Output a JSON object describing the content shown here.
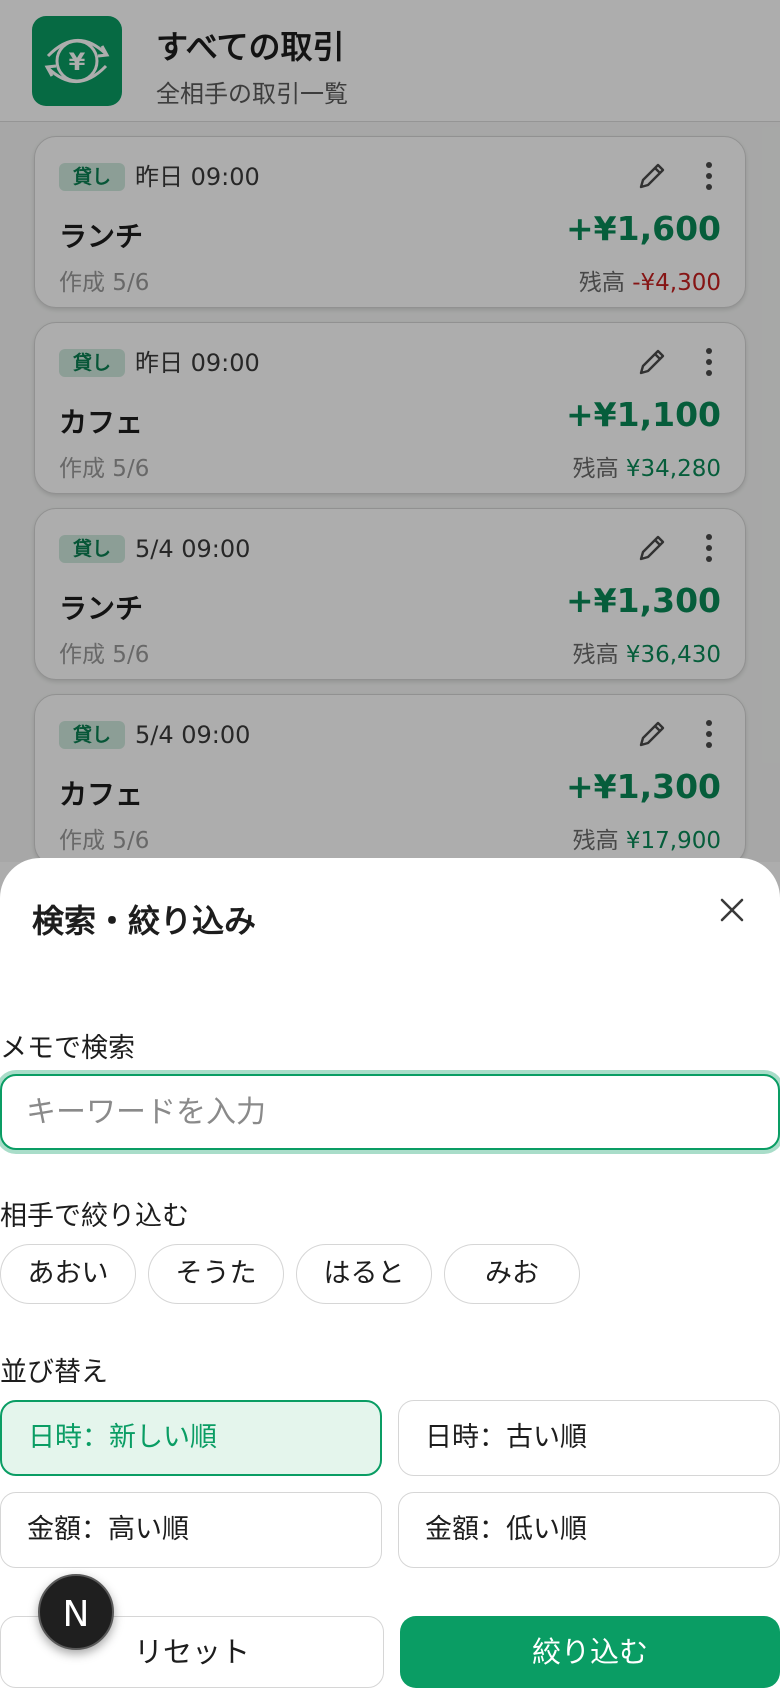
{
  "header": {
    "title": "すべての取引",
    "subtitle": "全相手の取引一覧",
    "icon": "yen-exchange-icon",
    "icon_glyph": "¥"
  },
  "transactions": [
    {
      "badge": "貸し",
      "date": "昨日 09:00",
      "title": "ランチ",
      "created": "作成 5/6",
      "amount": "+¥1,600",
      "balance_label": "残高",
      "balance": "-¥4,300"
    },
    {
      "badge": "貸し",
      "date": "昨日 09:00",
      "title": "カフェ",
      "created": "作成 5/6",
      "amount": "+¥1,100",
      "balance_label": "残高",
      "balance": "¥34,280"
    },
    {
      "badge": "貸し",
      "date": "5/4 09:00",
      "title": "ランチ",
      "created": "作成 5/6",
      "amount": "+¥1,300",
      "balance_label": "残高",
      "balance": "¥36,430"
    },
    {
      "badge": "貸し",
      "date": "5/4 09:00",
      "title": "カフェ",
      "created": "作成 5/6",
      "amount": "+¥1,300",
      "balance_label": "残高",
      "balance": "¥17,900"
    }
  ],
  "sheet": {
    "title": "検索・絞り込み",
    "search_label": "メモで検索",
    "search_placeholder": "キーワードを入力",
    "search_value": "",
    "partner_label": "相手で絞り込む",
    "partners": [
      "あおい",
      "そうた",
      "はると",
      "みお"
    ],
    "sort_label": "並び替え",
    "sort_options": [
      "日時：新しい順",
      "日時：古い順",
      "金額：高い順",
      "金額：低い順"
    ],
    "sort_selected": "日時：新しい順",
    "reset_label": "リセット",
    "apply_label": "絞り込む"
  },
  "fab": {
    "letter": "N"
  },
  "colors": {
    "accent": "#0a9d64",
    "positive": "#0a8a57",
    "negative": "#c62020",
    "badge_bg": "#cfe9dd"
  }
}
